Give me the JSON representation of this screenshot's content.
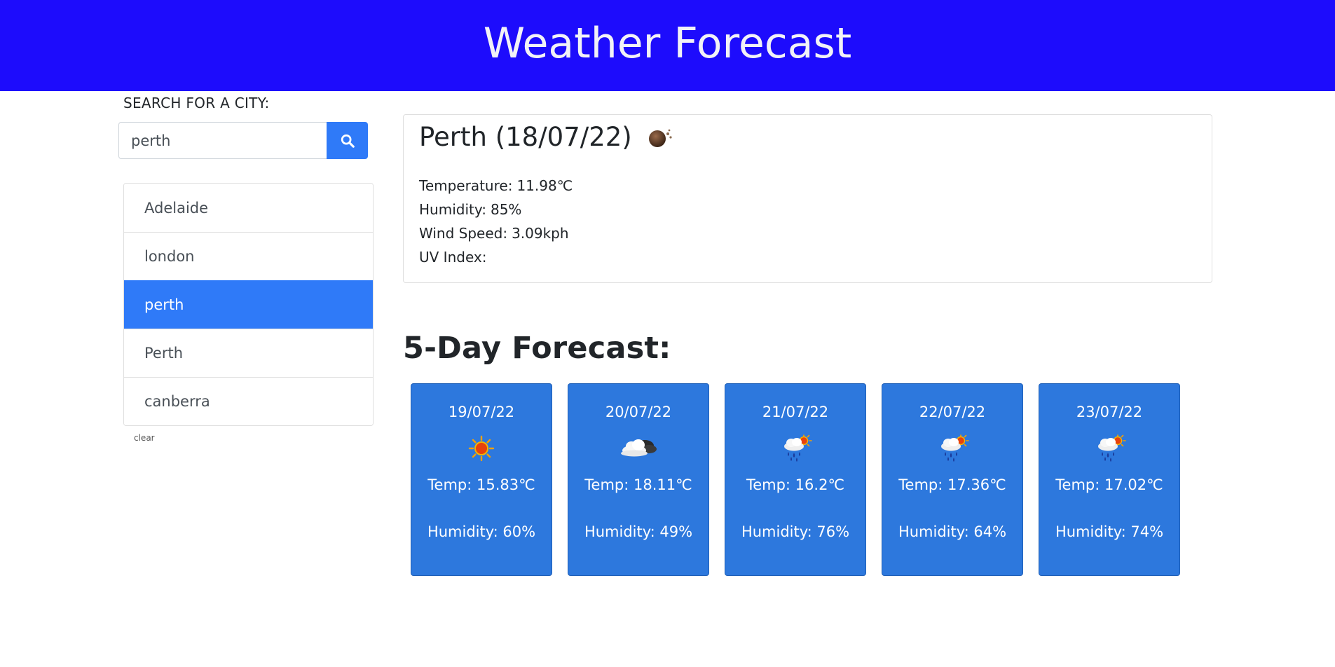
{
  "header": {
    "title": "Weather Forecast"
  },
  "search": {
    "label": "SEARCH FOR A CITY:",
    "value": "perth",
    "button_icon": "search-icon"
  },
  "history": {
    "items": [
      {
        "label": "Adelaide",
        "active": false
      },
      {
        "label": "london",
        "active": false
      },
      {
        "label": "perth",
        "active": true
      },
      {
        "label": "Perth",
        "active": false
      },
      {
        "label": "canberra",
        "active": false
      }
    ],
    "clear_label": "clear"
  },
  "current": {
    "title": "Perth (18/07/22)",
    "icon": "mist-icon",
    "temperature_label": "Temperature:",
    "temperature_value": "11.98℃",
    "humidity_label": "Humidity:",
    "humidity_value": "85%",
    "wind_label": "Wind Speed:",
    "wind_value": "3.09kph",
    "uv_label": "UV Index:",
    "uv_value": ""
  },
  "forecast": {
    "heading": "5-Day Forecast:",
    "days": [
      {
        "date": "19/07/22",
        "icon": "sun-icon",
        "temp": "Temp: 15.83℃",
        "humidity": "Humidity: 60%"
      },
      {
        "date": "20/07/22",
        "icon": "cloud-icon",
        "temp": "Temp: 18.11℃",
        "humidity": "Humidity: 49%"
      },
      {
        "date": "21/07/22",
        "icon": "rain-sun-icon",
        "temp": "Temp: 16.2℃",
        "humidity": "Humidity: 76%"
      },
      {
        "date": "22/07/22",
        "icon": "rain-sun-icon",
        "temp": "Temp: 17.36℃",
        "humidity": "Humidity: 64%"
      },
      {
        "date": "23/07/22",
        "icon": "rain-sun-icon",
        "temp": "Temp: 17.02℃",
        "humidity": "Humidity: 74%"
      }
    ]
  },
  "colors": {
    "header_bg": "#1d0cfc",
    "accent": "#2f7af8",
    "card_bg": "#2d78dd"
  }
}
